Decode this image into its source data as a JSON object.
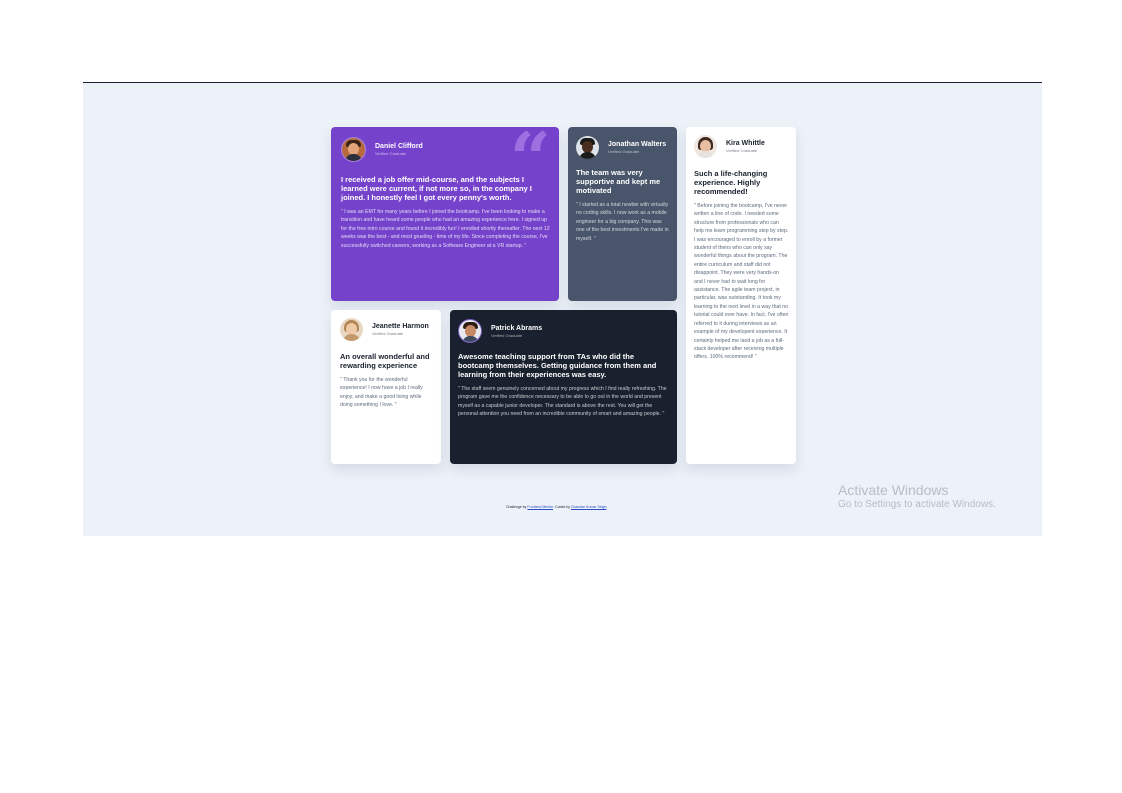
{
  "testimonials": [
    {
      "name": "Daniel Clifford",
      "status": "Verified Graduate",
      "headline": "I received a job offer mid-course, and the subjects I learned were current, if not more so, in the company I joined. I honestly feel I got every penny's worth.",
      "quote": "\" I was an EMT for many years before I joined the bootcamp. I've been looking to make a transition and have heard some people who had an amazing experience here. I signed up for the free intro course and found it incredibly fun! I enrolled shortly thereafter. The next 12 weeks was the best - and most grueling - time of my life. Since completing the course, I've successfully switched careers, working as a Software Engineer at a VR startup. \""
    },
    {
      "name": "Jonathan Walters",
      "status": "Verified Graduate",
      "headline": "The team was very supportive and kept me motivated",
      "quote": "\" I started as a total newbie with virtually no coding skills. I now work as a mobile engineer for a big company. This was one of the best investments I've made in myself. \""
    },
    {
      "name": "Jeanette Harmon",
      "status": "Verified Graduate",
      "headline": "An overall wonderful and rewarding experience",
      "quote": "\" Thank you for the wonderful experience! I now have a job I really enjoy, and make a good living while doing something I love. \""
    },
    {
      "name": "Patrick Abrams",
      "status": "Verified Graduate",
      "headline": "Awesome teaching support from TAs who did the bootcamp themselves. Getting guidance from them and learning from their experiences was easy.",
      "quote": "\" The staff seem genuinely concerned about my progress which I find really refreshing. The program gave me the confidence necessary to be able to go out in the world and present myself as a capable junior developer. The standard is above the rest. You will get the personal attention you need from an incredible community of smart and amazing people. \""
    },
    {
      "name": "Kira Whittle",
      "status": "Verified Graduate",
      "headline": "Such a life-changing experience. Highly recommended!",
      "quote": "\" Before joining the bootcamp, I've never written a line of code. I needed some structure from professionals who can help me learn programming step by step. I was encouraged to enroll by a former student of theirs who can only say wonderful things about the program. The entire curriculum and staff did not disappoint. They were very hands-on and I never had to wait long for assistance. The agile team project, in particular, was outstanding. It took my learning to the next level in a way that no tutorial could ever have. In fact, I've often referred to it during interviews as an example of my developent experience. It certainly helped me land a job as a full-stack developer after receiving multiple offers. 100% recommend! \""
    }
  ],
  "attribution": {
    "prefix": "Challenge by ",
    "author_link": "Frontend Mentor",
    "middle": ". Coded by ",
    "coder_link": "Chandan Kumar Singh",
    "suffix": "."
  },
  "watermark": {
    "title": "Activate Windows",
    "subtitle": "Go to Settings to activate Windows."
  },
  "colors": {
    "purple": "#7542cb",
    "slate": "#48556a",
    "navy": "#19212e",
    "background": "#edf2f8"
  },
  "icons": [
    "quotation-mark-icon",
    "avatar-daniel",
    "avatar-jonathan",
    "avatar-jeanette",
    "avatar-patrick",
    "avatar-kira"
  ]
}
